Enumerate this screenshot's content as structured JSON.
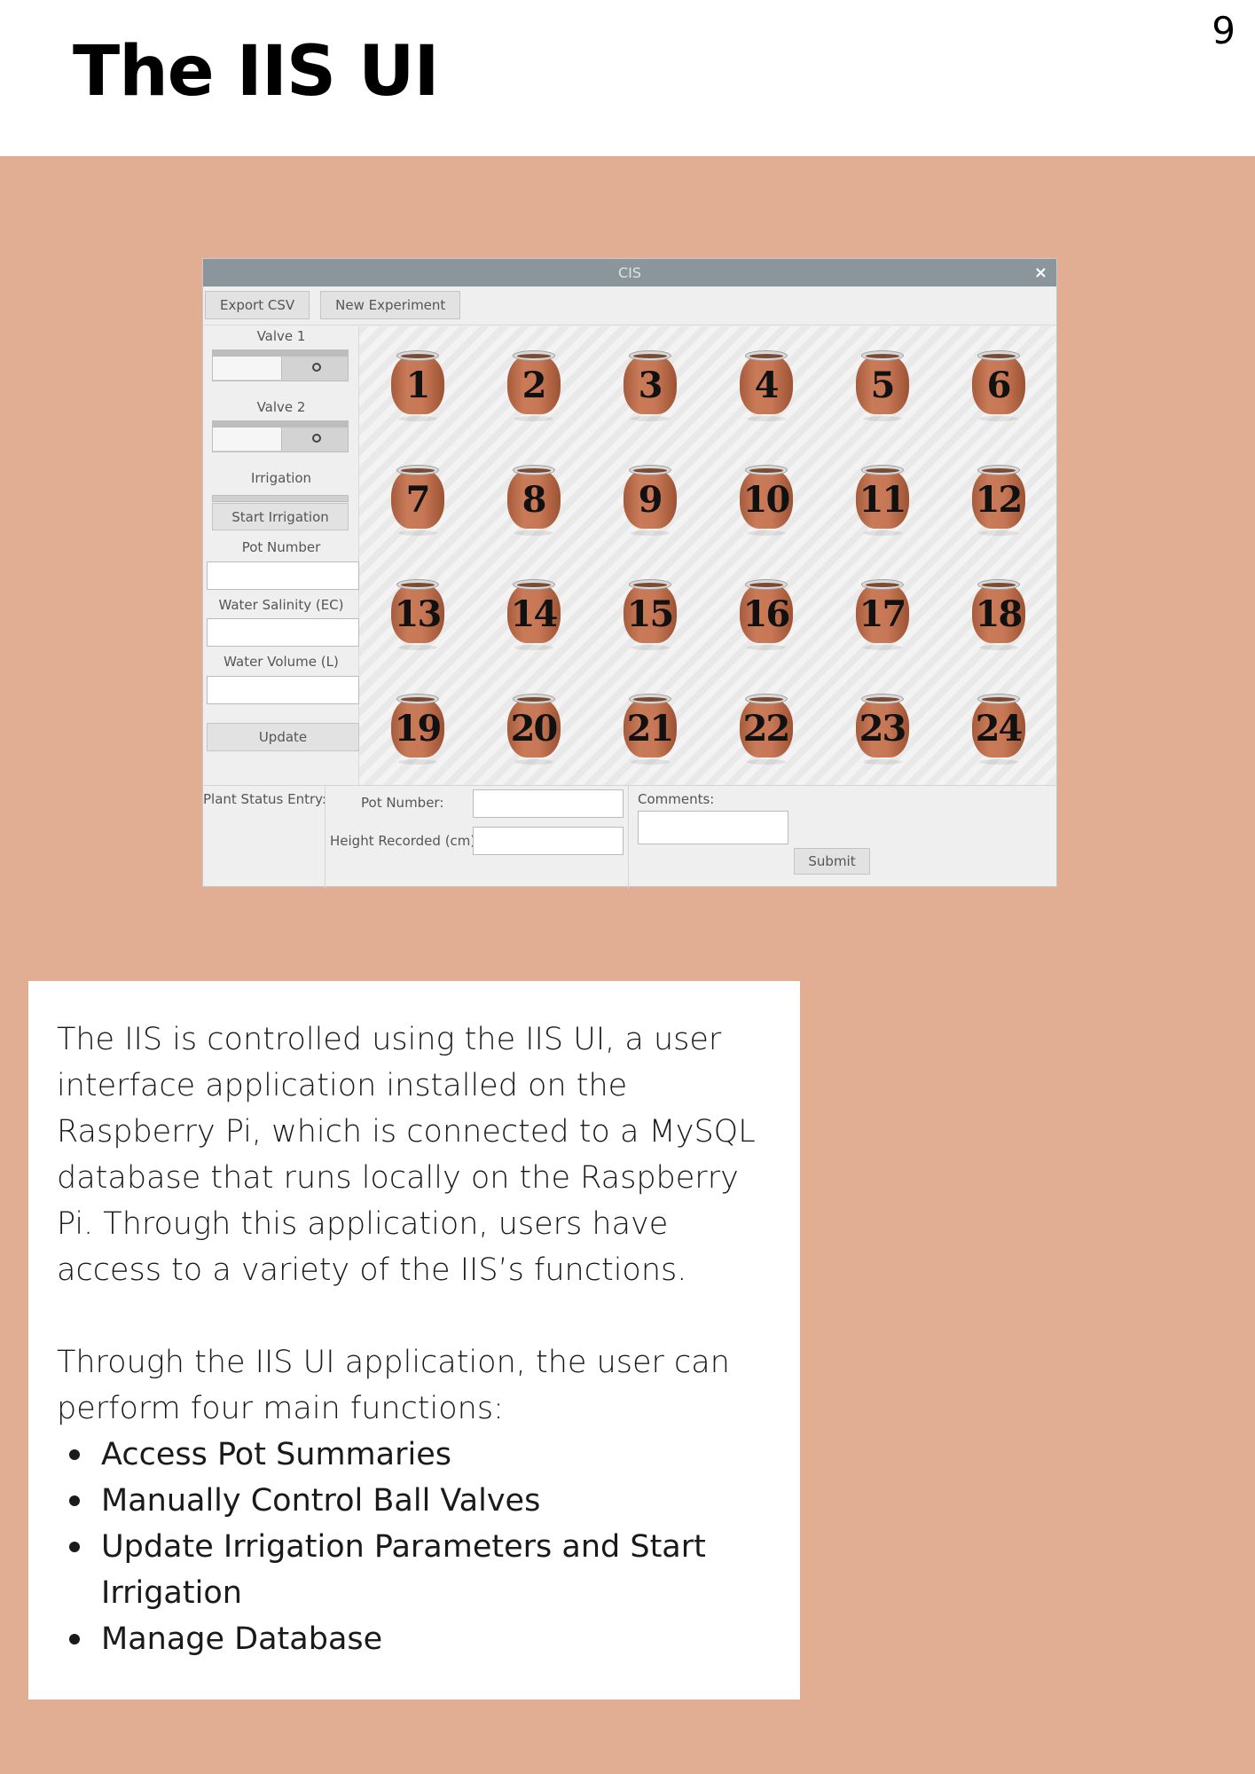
{
  "page": {
    "number": "9",
    "title": "The IIS UI"
  },
  "app": {
    "window_title": "CIS",
    "close_glyph": "×",
    "toolbar": {
      "export_label": "Export CSV",
      "new_experiment_label": "New Experiment"
    },
    "left_panel": {
      "valve1_label": "Valve 1",
      "valve2_label": "Valve 2",
      "irrigation_label": "Irrigation",
      "start_irrigation_label": "Start Irrigation",
      "pot_number_label": "Pot Number",
      "water_salinity_label": "Water Salinity (EC)",
      "water_volume_label": "Water Volume (L)",
      "update_label": "Update"
    },
    "pots": [
      "1",
      "2",
      "3",
      "4",
      "5",
      "6",
      "7",
      "8",
      "9",
      "10",
      "11",
      "12",
      "13",
      "14",
      "15",
      "16",
      "17",
      "18",
      "19",
      "20",
      "21",
      "22",
      "23",
      "24"
    ],
    "plant_status": {
      "entry_label": "Plant Status Entry:",
      "pot_number_label": "Pot Number:",
      "height_label": "Height Recorded (cm):",
      "comments_label": "Comments:",
      "submit_label": "Submit"
    }
  },
  "description": {
    "paragraph1": "The IIS is controlled using the IIS UI, a user interface application installed on the Raspberry Pi, which is connected to a MySQL database that runs locally on the Raspberry Pi. Through this application, users have access to a variety of the IIS’s functions.",
    "paragraph2": "Through the IIS UI application, the user can perform four main functions:",
    "functions": [
      "Access Pot Summaries",
      "Manually Control Ball Valves",
      "Update Irrigation Parameters and Start Irrigation",
      "Manage Database"
    ]
  },
  "colors": {
    "band": "#e2ae93",
    "titlebar": "#8a969c",
    "pot": "#c97b58"
  }
}
